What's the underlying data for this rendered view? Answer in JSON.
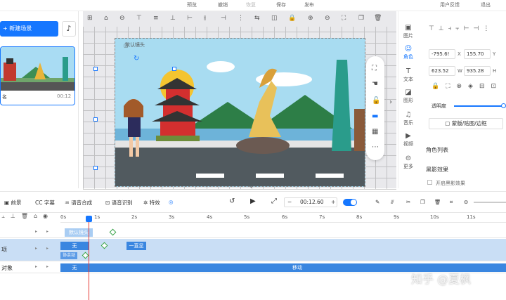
{
  "topbar": {
    "preview": "预览",
    "undo": "撤销",
    "redo": "恢复",
    "save": "保存",
    "publish": "发布",
    "feedback": "用户反馈",
    "exit": "退出"
  },
  "left": {
    "new_scene": "+ 新建场景",
    "scene_name": "名",
    "scene_duration": "00:12"
  },
  "stage": {
    "camera_label": "默认镜头"
  },
  "right_tabs": [
    "图片",
    "角色",
    "文本",
    "图形",
    "音乐",
    "视频",
    "更多"
  ],
  "props": {
    "x_val": "-795.6!",
    "x_label": "X",
    "y_val": "155.70",
    "y_label": "Y",
    "w_val": "623.52",
    "w_label": "W",
    "h_val": "935.28",
    "h_label": "H",
    "opacity_label": "透明度",
    "mask_btn": "蒙版/贴图/边框",
    "role_list": "角色列表",
    "blackscreen": "黑影效果",
    "blackscreen_toggle": "开启黑影效果"
  },
  "timeline_toolbar": {
    "foreground": "前景",
    "subtitle": "字幕",
    "voice_synth": "语音合成",
    "voice_recog": "语音识别",
    "effect": "特效",
    "time": "00:12.60",
    "minus": "−",
    "plus": "+"
  },
  "timeline": {
    "ticks": [
      "0s",
      "1s",
      "2s",
      "3s",
      "4s",
      "5s",
      "6s",
      "7s",
      "8s",
      "9s",
      "10s",
      "11s"
    ],
    "track1_bar": "默认镜头",
    "track2_bar": "无",
    "track2_bar2": "一直显",
    "track2_sub": "协余动",
    "track2_label": "项",
    "track3_label": "对象",
    "track3_bar": "无",
    "track3_move": "移动"
  },
  "watermark": "知乎 @夏枫",
  "colors": {
    "accent": "#1677ff",
    "timeline_bar": "#3a86e0",
    "timeline_light": "#a9cdf3"
  }
}
